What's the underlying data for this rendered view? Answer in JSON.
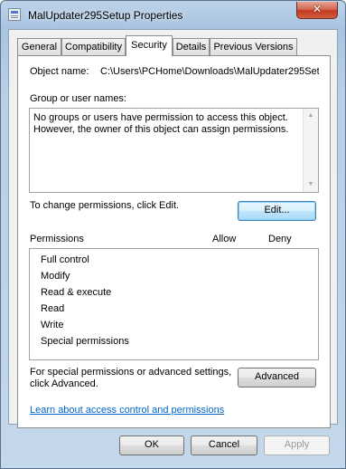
{
  "window": {
    "title": "MalUpdater295Setup Properties",
    "close_glyph": "✕"
  },
  "tabs": [
    {
      "label": "General"
    },
    {
      "label": "Compatibility"
    },
    {
      "label": "Security"
    },
    {
      "label": "Details"
    },
    {
      "label": "Previous Versions"
    }
  ],
  "active_tab": "Security",
  "object": {
    "label": "Object name:",
    "value": "C:\\Users\\PCHome\\Downloads\\MalUpdater295Set"
  },
  "groups": {
    "label": "Group or user names:",
    "message_line1": "No groups or users have permission to access this object.",
    "message_line2": "However, the owner of this object can assign permissions."
  },
  "change": {
    "text": "To change permissions, click Edit.",
    "edit_button": "Edit..."
  },
  "permissions": {
    "header": "Permissions",
    "allow": "Allow",
    "deny": "Deny",
    "items": [
      "Full control",
      "Modify",
      "Read & execute",
      "Read",
      "Write",
      "Special permissions"
    ]
  },
  "advanced": {
    "text_line1": "For special permissions or advanced settings,",
    "text_line2": "click Advanced.",
    "button": "Advanced"
  },
  "help_link": "Learn about access control and permissions",
  "footer": {
    "ok": "OK",
    "cancel": "Cancel",
    "apply": "Apply"
  },
  "colors": {
    "link": "#0066cc",
    "close_button": "#c2391f",
    "default_button_border": "#3c7fb1"
  }
}
